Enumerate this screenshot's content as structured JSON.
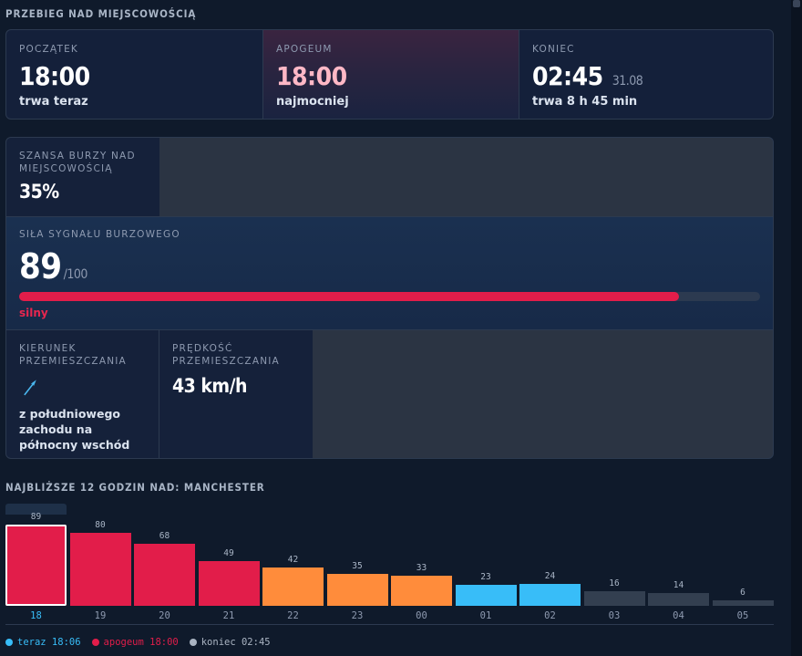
{
  "section_overview": {
    "title": "PRZEBIEG NAD MIEJSCOWOŚCIĄ"
  },
  "timeline": {
    "start": {
      "label": "POCZĄTEK",
      "time": "18:00",
      "note": "trwa teraz"
    },
    "peak": {
      "label": "APOGEUM",
      "time": "18:00",
      "note": "najmocniej"
    },
    "end": {
      "label": "KONIEC",
      "time": "02:45",
      "date": "31.08",
      "note": "trwa 8 h 45 min"
    }
  },
  "chance": {
    "label": "SZANSA BURZY NAD MIEJSCOWOŚCIĄ",
    "value": "35%"
  },
  "signal": {
    "label": "SIŁA SYGNAŁU BURZOWEGO",
    "value": "89",
    "max": "/100",
    "fraction": 0.89,
    "level": "silny",
    "color": "#e21d4a"
  },
  "direction": {
    "label": "KIERUNEK PRZEMIESZCZANIA",
    "icon": "arrow-northeast-icon",
    "text": "z południowego zachodu na północny wschód"
  },
  "speed": {
    "label": "PRĘDKOŚĆ PRZEMIESZCZANIA",
    "value": "43 km/h"
  },
  "section_hours": {
    "title": "NAJBLIŻSZE 12 GODZIN NAD: MANCHESTER"
  },
  "chart_data": {
    "type": "bar",
    "categories": [
      "18",
      "19",
      "20",
      "21",
      "22",
      "23",
      "00",
      "01",
      "02",
      "03",
      "04",
      "05"
    ],
    "values": [
      89,
      80,
      68,
      49,
      42,
      35,
      33,
      23,
      24,
      16,
      14,
      6
    ],
    "colors": [
      "#e21d4a",
      "#e21d4a",
      "#e21d4a",
      "#e21d4a",
      "#ff8c3b",
      "#ff8c3b",
      "#ff8c3b",
      "#38bdf8",
      "#38bdf8",
      "#333f50",
      "#333f50",
      "#333f50"
    ],
    "ylim": [
      0,
      100
    ],
    "highlight_index": 0
  },
  "legend": [
    {
      "text": "teraz 18:06",
      "color": "#38bdf8"
    },
    {
      "text": "apogeum 18:00",
      "color": "#e21d4a"
    },
    {
      "text": "koniec 02:45",
      "color": "#aab4c2"
    }
  ]
}
